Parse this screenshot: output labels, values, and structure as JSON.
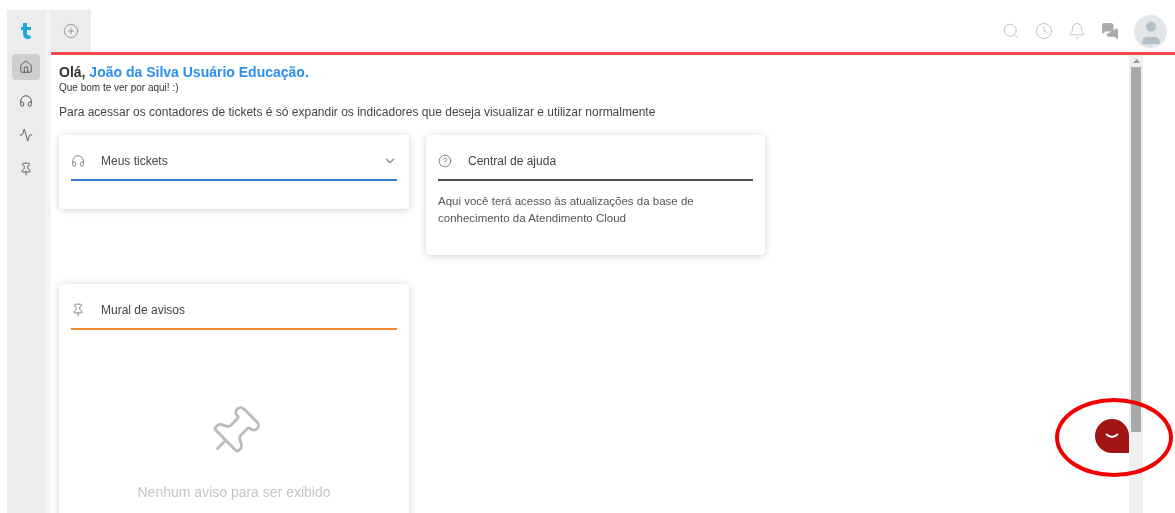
{
  "sidebar": {
    "items": [
      {
        "kind": "home",
        "selected": true
      },
      {
        "kind": "headset",
        "selected": false
      },
      {
        "kind": "chart",
        "selected": false
      },
      {
        "kind": "pin",
        "selected": false
      }
    ]
  },
  "greeting": {
    "prefix": "Olá,",
    "name": "João da Silva Usuário Educação.",
    "subtitle": "Que bom te ver por aqui! :)"
  },
  "instructions": "Para acessar os contadores de tickets é só expandir os indicadores que deseja visualizar e utilizar normalmente",
  "cards": [
    {
      "kind": "tickets",
      "title": "Meus tickets",
      "color": "#3a7bd5",
      "expanded": false
    },
    {
      "kind": "help",
      "title": "Central de ajuda",
      "color": "#4a5459",
      "body": "Aqui você terá acesso às atualizações da base de conhecimento da Atendimento Cloud"
    },
    {
      "kind": "notices",
      "title": "Mural de avisos",
      "color": "#f28c28",
      "empty_text": "Nenhum aviso para ser exibido"
    }
  ],
  "chat_highlighted": true
}
